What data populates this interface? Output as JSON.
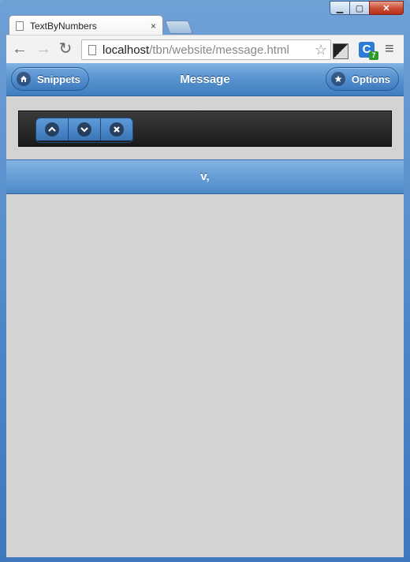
{
  "browser": {
    "tab_title": "TextByNumbers",
    "tab_close": "×",
    "url_host": "localhost",
    "url_path": "/tbn/website/message.html",
    "extension_badge": "7",
    "extension_letter": "C"
  },
  "header": {
    "title": "Message",
    "left_button": "Snippets",
    "right_button": "Options"
  },
  "controls": {
    "up_icon": "chevron-up-icon",
    "down_icon": "chevron-down-icon",
    "close_icon": "close-icon"
  },
  "message": {
    "text": "v,"
  },
  "colors": {
    "header_blue": "#4d89c9",
    "page_bg": "#d3d3d3",
    "control_bar": "#222222"
  }
}
